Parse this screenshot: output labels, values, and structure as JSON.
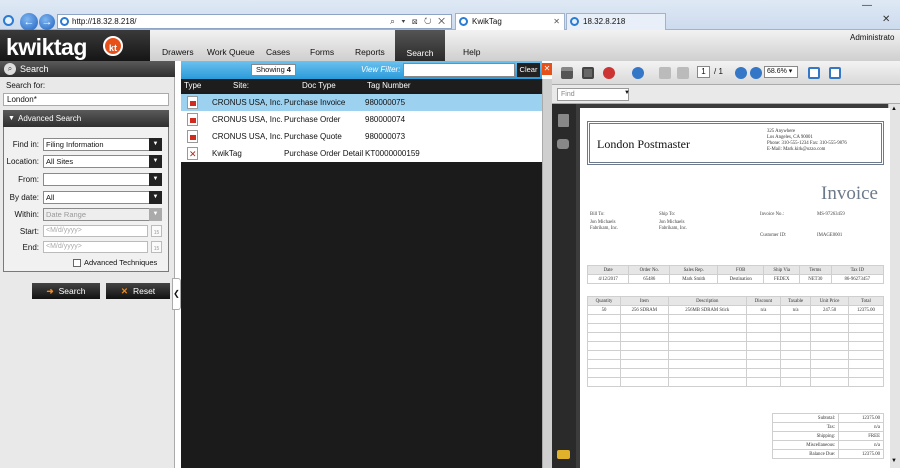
{
  "browser": {
    "address": "http://18.32.8.218/",
    "addr_icons": "⌕ ▾ ⊠ ↻ ✕",
    "tabs": [
      {
        "label": "KwikTag",
        "close": "✕"
      },
      {
        "label": "18.32.8.218",
        "close": ""
      }
    ],
    "back": "←",
    "forward": "→",
    "win_min": "—",
    "win_close": "✕"
  },
  "app": {
    "logo": "kwiktag",
    "logo_badge": "kt",
    "menu": [
      "Drawers",
      "Work Queue",
      "Cases",
      "Forms",
      "Reports",
      "Search",
      "Help"
    ],
    "user": "Administrato"
  },
  "search_panel": {
    "header": "Search",
    "search_for_label": "Search for:",
    "search_for_value": "London*",
    "advanced_header": "Advanced Search",
    "fields": {
      "find_in": {
        "label": "Find in:",
        "value": "Filing Information"
      },
      "location": {
        "label": "Location:",
        "value": "All Sites"
      },
      "from": {
        "label": "From:",
        "value": ""
      },
      "by_date": {
        "label": "By date:",
        "value": "All"
      },
      "within": {
        "label": "Within:",
        "value": "Date Range"
      },
      "start": {
        "label": "Start:",
        "placeholder": "<M/d/yyyy>"
      },
      "end": {
        "label": "End:",
        "placeholder": "<M/d/yyyy>"
      }
    },
    "calendar_day": "15",
    "advanced_techniques": "Advanced Techniques",
    "search_button": "Search",
    "reset_button": "Reset",
    "collapse_glyph": "❮"
  },
  "results": {
    "showing_label": "Showing",
    "showing_count": "4",
    "view_filter_label": "View Filter:",
    "clear_button": "Clear",
    "close_glyph": "✕",
    "columns": [
      "Type",
      "Site:",
      "Doc Type",
      "Tag Number"
    ],
    "rows": [
      {
        "type": "pdf",
        "site": "CRONUS USA, Inc.",
        "doc_type": "Purchase Invoice",
        "tag": "980000075"
      },
      {
        "type": "pdf",
        "site": "CRONUS USA, Inc.",
        "doc_type": "Purchase Order",
        "tag": "980000074"
      },
      {
        "type": "pdf",
        "site": "CRONUS USA, Inc.",
        "doc_type": "Purchase Quote",
        "tag": "980000073"
      },
      {
        "type": "kwiktag",
        "site": "KwikTag",
        "doc_type": "Purchase Order Detail",
        "tag": "KT0000000159"
      }
    ]
  },
  "viewer": {
    "page_current": "1",
    "page_total": "/ 1",
    "zoom": "68.6%",
    "find_placeholder": "Find"
  },
  "invoice": {
    "company": "London Postmaster",
    "address_lines": [
      "325 Anywhere",
      "Los Angeles, CA 90001",
      "Phone: 310-555-1234  Fax: 310-555-9876",
      "E-Mail: Mark.kirk@ozzo.com"
    ],
    "title": "Invoice",
    "bill_to_label": "Bill To:",
    "bill_to": [
      "Jon Michaels",
      "Fabrikam, Inc."
    ],
    "ship_to_label": "Ship To:",
    "ship_to": [
      "Jon Michaels",
      "Fabrikam, Inc."
    ],
    "invoice_no_label": "Invoice No.:",
    "invoice_no": "MS-97263459",
    "customer_id_label": "Customer ID:",
    "customer_id": "IMAGE0001",
    "order_headers": [
      "Date",
      "Order No.",
      "Sales Rep.",
      "FOB",
      "Ship Via",
      "Terms",
      "Tax ID"
    ],
    "order_values": [
      "4/12/2017",
      "65486",
      "Mark Smith",
      "Destination",
      "FEDEX",
      "NET30",
      "86-96273457"
    ],
    "item_headers": [
      "Quantity",
      "Item",
      "Description",
      "Discount",
      "Taxable",
      "Unit Price",
      "Total"
    ],
    "item_values": [
      "50",
      "256 SDRAM",
      "256MB SDRAM Stick",
      "n/a",
      "n/a",
      "247.50",
      "12375.00"
    ],
    "summary": [
      {
        "label": "Subtotal:",
        "value": "12375.00"
      },
      {
        "label": "Tax:",
        "value": "n/a"
      },
      {
        "label": "Shipping:",
        "value": "FREE"
      },
      {
        "label": "Miscellaneous:",
        "value": "n/a"
      },
      {
        "label": "Balance Due:",
        "value": "12375.00"
      }
    ]
  }
}
